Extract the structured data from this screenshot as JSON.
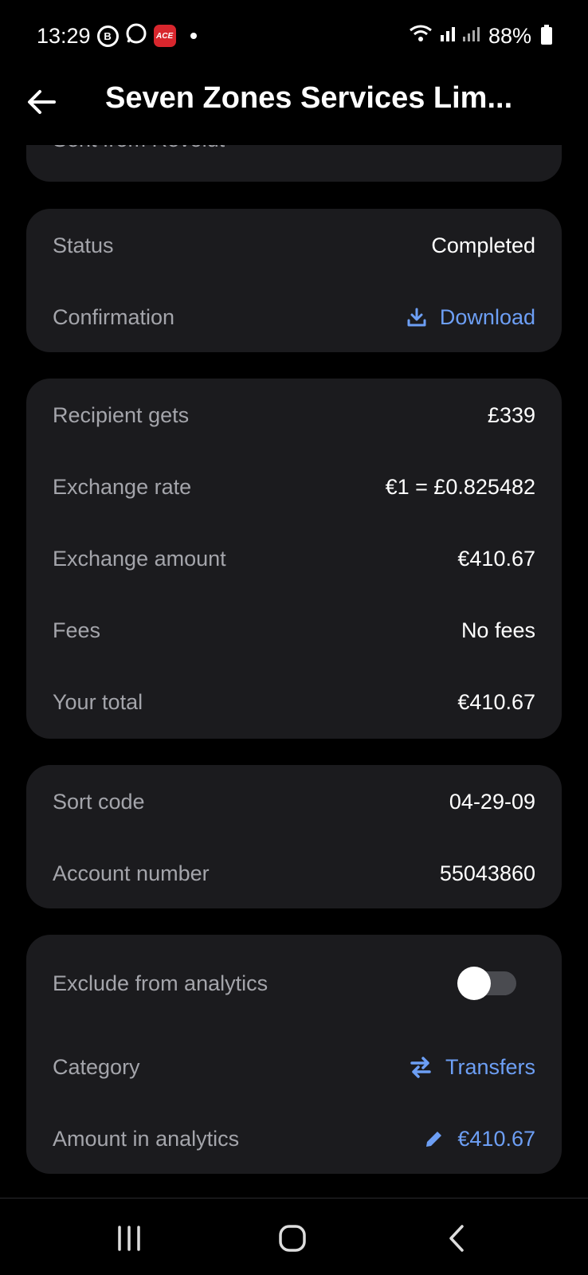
{
  "status_bar": {
    "time": "13:29",
    "battery": "88%",
    "icons": [
      "b-notification-icon",
      "whatsapp-icon",
      "ace-app-icon",
      "wifi-icon",
      "signal-icon"
    ],
    "ace_label": "ACE"
  },
  "header": {
    "title": "Seven Zones Services Lim..."
  },
  "partial_card": {
    "text": "Sent from Revolut"
  },
  "status_card": {
    "status_label": "Status",
    "status_value": "Completed",
    "confirmation_label": "Confirmation",
    "download_label": "Download"
  },
  "exchange_card": {
    "rows": [
      {
        "label": "Recipient gets",
        "value": "£339"
      },
      {
        "label": "Exchange rate",
        "value": "€1 = £0.825482"
      },
      {
        "label": "Exchange amount",
        "value": "€410.67"
      },
      {
        "label": "Fees",
        "value": "No fees"
      },
      {
        "label": "Your total",
        "value": "€410.67"
      }
    ]
  },
  "bank_card": {
    "sort_code_label": "Sort code",
    "sort_code_value": "04-29-09",
    "account_label": "Account number",
    "account_value": "55043860"
  },
  "analytics_card": {
    "exclude_label": "Exclude from analytics",
    "exclude_enabled": false,
    "category_label": "Category",
    "category_value": "Transfers",
    "amount_label": "Amount in analytics",
    "amount_value": "€410.67"
  },
  "colors": {
    "background": "#000000",
    "card": "#1b1b1e",
    "label": "#a4a5ab",
    "accent": "#6d9ff5"
  }
}
